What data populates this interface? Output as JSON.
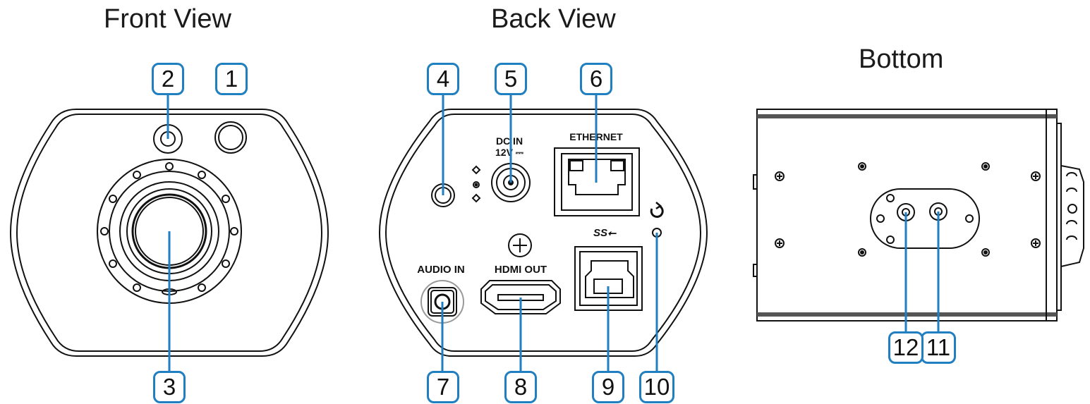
{
  "views": {
    "front": "Front View",
    "back": "Back View",
    "bottom": "Bottom"
  },
  "ports": {
    "dc_in": "DC IN",
    "dc_volt": "12V ⎓",
    "ethernet": "ETHERNET",
    "audio_in": "AUDIO IN",
    "hdmi_out": "HDMI OUT",
    "usb": "SS⭠"
  },
  "callouts": [
    "1",
    "2",
    "3",
    "4",
    "5",
    "6",
    "7",
    "8",
    "9",
    "10",
    "11",
    "12"
  ],
  "colors": {
    "callout_border": "#1f7fc0",
    "outline": "#111111"
  }
}
